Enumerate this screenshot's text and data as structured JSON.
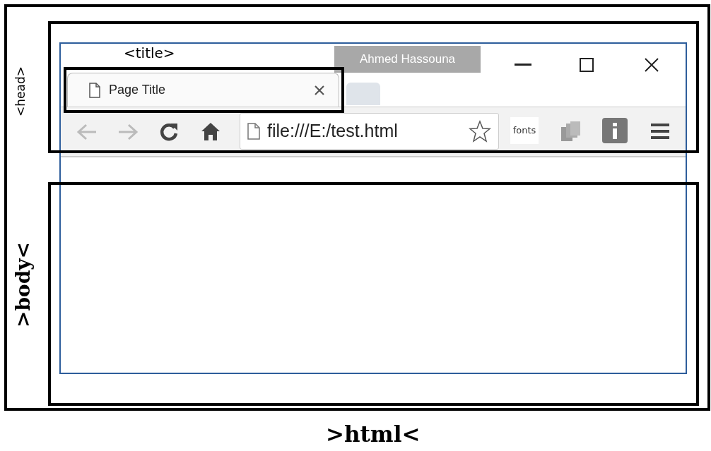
{
  "annotations": {
    "title_label": "<title>",
    "head_label": "<head>",
    "body_label": ">body<",
    "html_label": ">html<"
  },
  "browser": {
    "profile_name": "Ahmed Hassouna",
    "tabs": [
      {
        "title": "Page Title",
        "selected": true
      }
    ],
    "address": "file:///E:/test.html",
    "extension_label": "fonts"
  }
}
